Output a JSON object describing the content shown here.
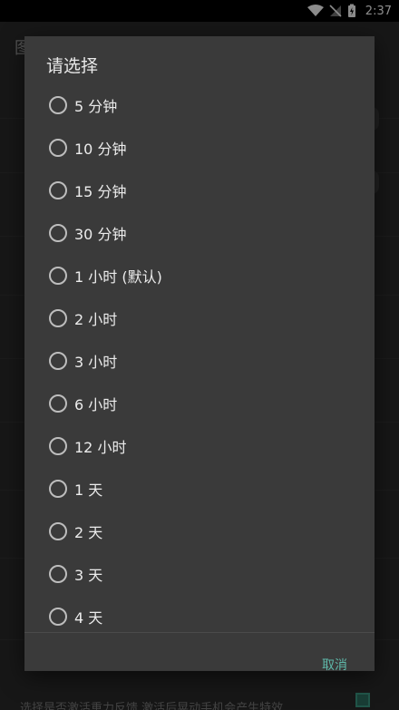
{
  "status_bar": {
    "time": "2:37"
  },
  "background": {
    "appbar_title_fragment": "图",
    "bottom_fragment": "选择是否激活重力反馈 激活后晃动手机会产生特效"
  },
  "dialog": {
    "title": "请选择",
    "options": [
      {
        "label": "5 分钟"
      },
      {
        "label": "10 分钟"
      },
      {
        "label": "15 分钟"
      },
      {
        "label": "30 分钟"
      },
      {
        "label": "1 小时 (默认)"
      },
      {
        "label": "2 小时"
      },
      {
        "label": "3 小时"
      },
      {
        "label": "6 小时"
      },
      {
        "label": "12 小时"
      },
      {
        "label": "1 天"
      },
      {
        "label": "2 天"
      },
      {
        "label": "3 天"
      },
      {
        "label": "4 天"
      }
    ],
    "cancel_label": "取消"
  },
  "colors": {
    "accent": "#5fb8a9"
  }
}
